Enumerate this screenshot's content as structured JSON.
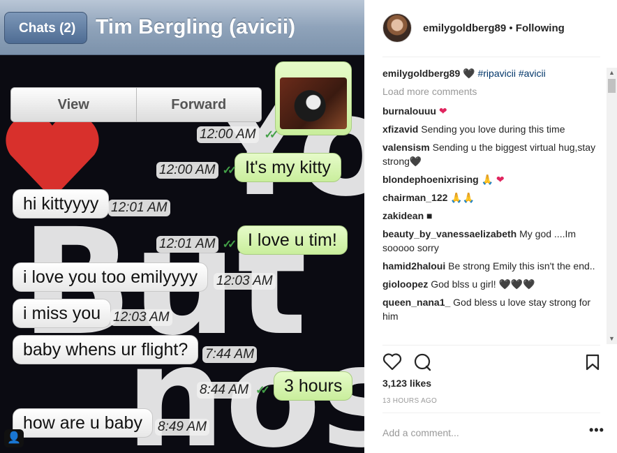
{
  "chat": {
    "back_label": "Chats (2)",
    "title": "Tim Bergling (avicii)",
    "actions": [
      "View",
      "Forward"
    ],
    "messages": [
      {
        "dir": "out",
        "text": "",
        "time": "12:00 AM"
      },
      {
        "dir": "out",
        "text": "It's my kitty",
        "time": "12:00 AM"
      },
      {
        "dir": "in",
        "text": "hi kittyyyy",
        "time": "12:01 AM"
      },
      {
        "dir": "out",
        "text": "I love u tim!",
        "time": "12:01 AM"
      },
      {
        "dir": "in",
        "text": "i love you too emilyyyy",
        "time": "12:03 AM"
      },
      {
        "dir": "in",
        "text": "i miss you",
        "time": "12:03 AM"
      },
      {
        "dir": "in",
        "text": "baby whens ur flight?",
        "time": "7:44 AM"
      },
      {
        "dir": "out",
        "text": "3 hours",
        "time": "8:44 AM"
      },
      {
        "dir": "in",
        "text": "how are u baby",
        "time": "8:49 AM"
      }
    ]
  },
  "post": {
    "username": "emilygoldberg89",
    "follow_status": "Following",
    "caption": {
      "user": "emilygoldberg89",
      "emoji": "🖤",
      "tags": "#ripavicii #avicii"
    },
    "load_more": "Load more comments",
    "comments": [
      {
        "user": "burnalouuu",
        "text": "",
        "emoji": "❤"
      },
      {
        "user": "xfizavid",
        "text": "Sending you love during this time",
        "emoji": ""
      },
      {
        "user": "valensism",
        "text": "Sending u the biggest virtual hug,stay strong",
        "emoji": "🖤"
      },
      {
        "user": "blondephoenixrising",
        "text": "",
        "emoji": "🙏 ❤"
      },
      {
        "user": "chairman_122",
        "text": "",
        "emoji": "🙏🙏"
      },
      {
        "user": "zakidean",
        "text": "",
        "emoji": "■"
      },
      {
        "user": "beauty_by_vanessaelizabeth",
        "text": "My god ....Im sooooo sorry",
        "emoji": ""
      },
      {
        "user": "hamid2haloui",
        "text": "Be strong Emily this isn't the end..",
        "emoji": ""
      },
      {
        "user": "gioloopez",
        "text": "God blss u girl!",
        "emoji": "🖤🖤🖤"
      },
      {
        "user": "queen_nana1_",
        "text": "God bless u love stay strong for him",
        "emoji": ""
      }
    ],
    "likes": "3,123 likes",
    "time_ago": "13 HOURS AGO",
    "add_comment_placeholder": "Add a comment...",
    "more_label": "•••"
  },
  "colors": {
    "accent_link": "#003569",
    "heart": "#e0245e",
    "chat_out": "#c9ee9c",
    "tick": "#43a047"
  }
}
